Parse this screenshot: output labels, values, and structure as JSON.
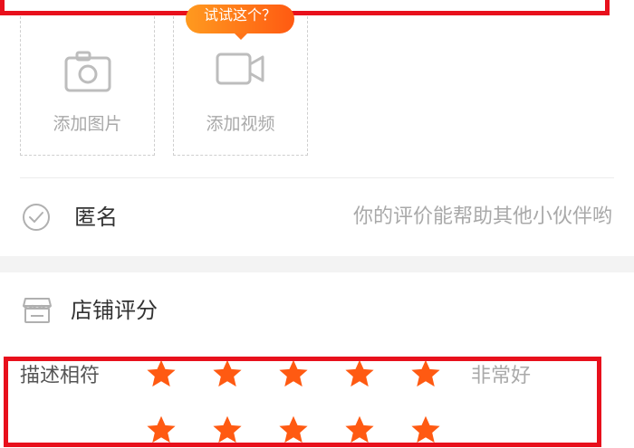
{
  "upload": {
    "tooltip": "试试这个？",
    "photo_label": "添加图片",
    "video_label": "添加视频"
  },
  "anonymous": {
    "label": "匿名",
    "hint": "你的评价能帮助其他小伙伴哟"
  },
  "shop_rating": {
    "title": "店铺评分",
    "rows": [
      {
        "label": "描述相符",
        "stars": 5,
        "text": "非常好"
      },
      {
        "label": "",
        "stars": 5,
        "text": ""
      }
    ]
  },
  "colors": {
    "star": "#ff5a12",
    "annotation": "#e8101c",
    "accent_start": "#ff9a1f",
    "accent_end": "#ff5a12"
  }
}
